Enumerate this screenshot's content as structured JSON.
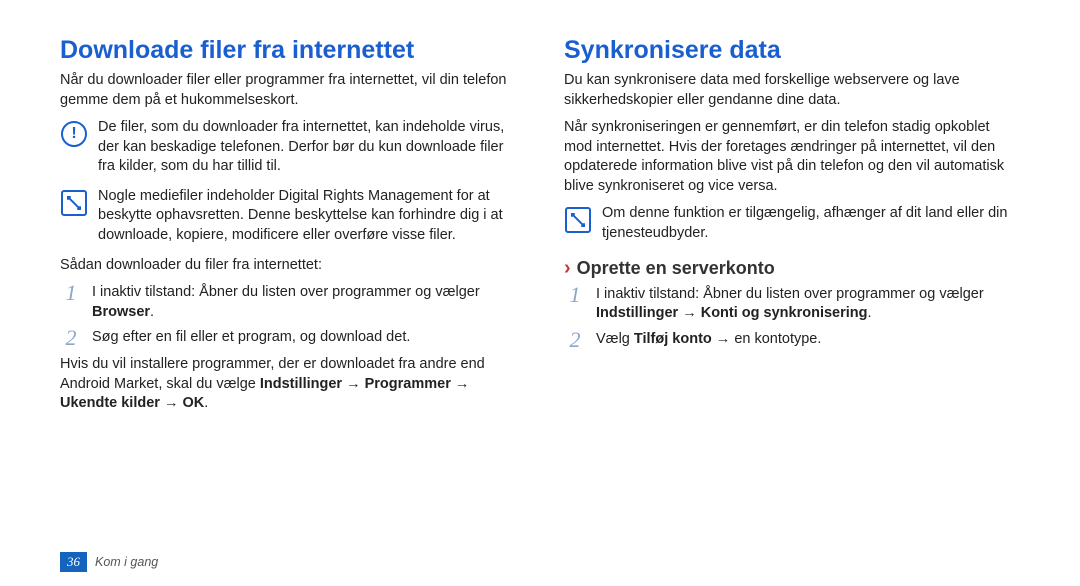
{
  "left": {
    "title": "Downloade filer fra internettet",
    "intro": "Når du downloader filer eller programmer fra internettet, vil din telefon gemme dem på et hukommelseskort.",
    "warn": "De filer, som du downloader fra internettet, kan indeholde virus, der kan beskadige telefonen. Derfor bør du kun downloade filer fra kilder, som du har tillid til.",
    "info": "Nogle mediefiler indeholder Digital Rights Management for at beskytte ophavsretten. Denne beskyttelse kan forhindre dig i at downloade, kopiere, modificere eller overføre visse filer.",
    "lead": "Sådan downloader du filer fra internettet:",
    "step1_pre": "I inaktiv tilstand: Åbner du listen over programmer og vælger ",
    "step1_bold": "Browser",
    "step1_post": ".",
    "step2": "Søg efter en fil eller et program, og download det.",
    "tail_pre": "Hvis du vil installere programmer, der er downloadet fra andre end Android Market, skal du vælge ",
    "tail_bold": "Indstillinger → Programmer → Ukendte kilder → OK",
    "tail_post": "."
  },
  "right": {
    "title": "Synkronisere data",
    "p1": "Du kan synkronisere data med forskellige webservere og lave sikkerhedskopier eller gendanne dine data.",
    "p2": "Når synkroniseringen er gennemført, er din telefon stadig opkoblet mod internettet. Hvis der foretages ændringer på internettet, vil den opdaterede information blive vist på din telefon og den vil automatisk blive synkroniseret og vice versa.",
    "info": "Om denne funktion er tilgængelig, afhænger af dit land eller din tjenesteudbyder.",
    "subhead": "Oprette en serverkonto",
    "step1_pre": "I inaktiv tilstand: Åbner du listen over programmer og vælger ",
    "step1_bold": "Indstillinger → Konti og synkronisering",
    "step1_post": ".",
    "step2_pre": "Vælg ",
    "step2_bold": "Tilføj konto",
    "step2_post": " → en kontotype."
  },
  "footer": {
    "page": "36",
    "section": "Kom i gang"
  }
}
